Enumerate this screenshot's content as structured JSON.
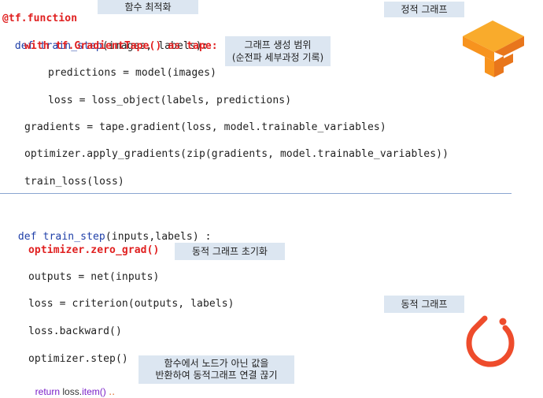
{
  "labels": {
    "tf_function": "함수 최적화",
    "static_graph_top": "정적 그래프",
    "graph_scope_line1": "그래프 생성 범위",
    "graph_scope_line2": "(순전파 세부과정 기록)",
    "dynamic_init": "동적 그래프 초기화",
    "dynamic_graph": "동적 그래프",
    "detach_line1": "함수에서 노드가 아닌 값을",
    "detach_line2": "반환하여 동적그래프 연결 끊기"
  },
  "tf_code": {
    "line1": "@tf.function",
    "line2_def": "def",
    "line2_fn": "train_step",
    "line2_args": "(images, labels):",
    "line3": "with tf.GradientTape() as tape:",
    "line4": "predictions = model(images)",
    "line5": "loss = loss_object(labels, predictions)",
    "line6": "gradients = tape.gradient(loss, model.trainable_variables)",
    "line7": "optimizer.apply_gradients(zip(gradients, model.trainable_variables))",
    "line8": "train_loss(loss)"
  },
  "torch_code": {
    "line1_def": "def",
    "line1_fn": "train_step",
    "line1_args": "(inputs,labels) :",
    "line2": "optimizer.zero_grad()",
    "line3": "outputs = net(inputs)",
    "line4": "loss = criterion(outputs, labels)",
    "line5": "loss.backward()",
    "line6": "optimizer.step()",
    "line7_return": "return",
    "line7_loss": "loss.",
    "line7_item": "item()",
    "line7_tail": " ‥"
  },
  "colors": {
    "tensorflow_orange": "#f7931e",
    "tensorflow_orange_dark": "#e8761c",
    "pytorch_orange": "#ee4c2c"
  },
  "icons": {
    "tf_logo": "tensorflow-logo-icon",
    "torch_logo": "pytorch-logo-icon"
  }
}
